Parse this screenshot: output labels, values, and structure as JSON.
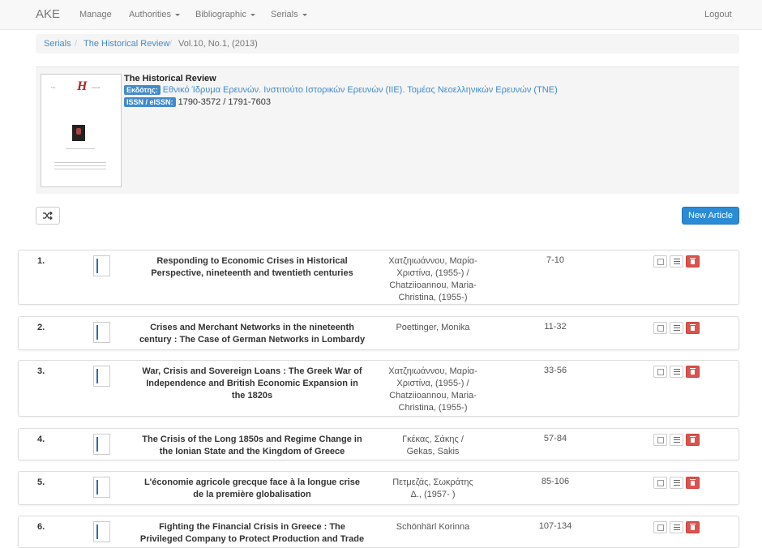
{
  "navbar": {
    "brand": "AKE",
    "items": [
      "Manage",
      "Authorities",
      "Bibliographic",
      "Serials"
    ],
    "logout": "Logout"
  },
  "breadcrumb": {
    "items": [
      "Serials",
      "The Historical Review",
      "Vol.10, No.1, (2013)"
    ]
  },
  "serial": {
    "title": "The Historical Review",
    "publisher_label": "Εκδότης:",
    "publisher": "Εθνικό Ίδρυμα Ερευνών. Ινστιτούτο Ιστορικών Ερευνών (ΙΙΕ). Τομέας Νεοελληνικών Ερευνών (ΤΝΕ)",
    "issn_label": "ISSN / eISSN:",
    "issn": "1790-3572 / 1791-7603",
    "cover_icon": "journal-cover"
  },
  "toolbar": {
    "shuffle_icon": "shuffle-icon",
    "new_article": "New Article"
  },
  "articles": [
    {
      "num": "1.",
      "title_lines": [
        "Responding to Economic Crises in Historical",
        "Perspective, nineteenth and twentieth centuries"
      ],
      "author_lines": [
        "Χατζηιωάννου, Μαρία-",
        "Χριστίνα, (1955-) /",
        "Chatziioannou, Maria-",
        "Christina, (1955-)"
      ],
      "pages": "7-10"
    },
    {
      "num": "2.",
      "title_lines": [
        "Crises and Merchant Networks in the nineteenth",
        "century : The Case of German Networks in Lombardy"
      ],
      "author_lines": [
        "Poettinger, Monika"
      ],
      "pages": "11-32"
    },
    {
      "num": "3.",
      "title_lines": [
        "War, Crisis and Sovereign Loans : The Greek War of",
        "Independence and British Economic Expansion in",
        "the 1820s"
      ],
      "author_lines": [
        "Χατζηιωάννου, Μαρία-",
        "Χριστίνα, (1955-) /",
        "Chatziioannou, Maria-",
        "Christina, (1955-)"
      ],
      "pages": "33-56"
    },
    {
      "num": "4.",
      "title_lines": [
        "The Crisis of the Long 1850s and Regime Change in",
        "the Ionian State and the Kingdom of Greece"
      ],
      "author_lines": [
        "Γκέκας, Σάκης /",
        "Gekas, Sakis"
      ],
      "pages": "57-84"
    },
    {
      "num": "5.",
      "title_lines": [
        "L'économie agricole grecque face à la longue crise",
        "de la première globalisation"
      ],
      "author_lines": [
        "Πετμεζάς, Σωκράτης",
        "Δ., (1957- )"
      ],
      "pages": "85-106"
    },
    {
      "num": "6.",
      "title_lines": [
        "Fighting the Financial Crisis in Greece : The",
        "Privileged Company to Protect Production and Trade"
      ],
      "author_lines": [
        "Schönhärl Korinna"
      ],
      "pages": "107-134"
    }
  ],
  "colors": {
    "link": "#428bca",
    "primary_button": "#2a8bd6",
    "danger": "#d9534f"
  }
}
